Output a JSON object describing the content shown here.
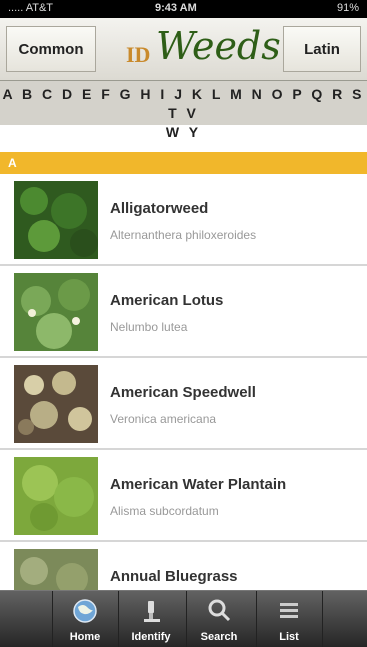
{
  "status_bar": {
    "carrier": "..... AT&T",
    "time": "9:43 AM",
    "battery": "91%"
  },
  "header": {
    "common_label": "Common",
    "latin_label": "Latin",
    "logo_id": "ID",
    "logo_weeds": "Weeds"
  },
  "alphabet": {
    "line1": "A B C D E F G H I J K L M N O P Q R S T V",
    "line2": "W Y"
  },
  "section": {
    "label": "A"
  },
  "weeds": [
    {
      "name": "Alligatorweed",
      "latin": "Alternanthera philoxeroides"
    },
    {
      "name": "American Lotus",
      "latin": "Nelumbo lutea"
    },
    {
      "name": "American Speedwell",
      "latin": "Veronica americana"
    },
    {
      "name": "American Water Plantain",
      "latin": "Alisma subcordatum"
    },
    {
      "name": "Annual Bluegrass",
      "latin": ""
    }
  ],
  "tabs": [
    {
      "label": "Home",
      "icon": "globe-icon"
    },
    {
      "label": "Identify",
      "icon": "microscope-icon"
    },
    {
      "label": "Search",
      "icon": "magnifier-icon"
    },
    {
      "label": "List",
      "icon": "list-icon"
    }
  ],
  "colors": {
    "section_bar": "#f1b72b",
    "logo_green": "#2e5e17",
    "logo_orange": "#c98a2c"
  }
}
